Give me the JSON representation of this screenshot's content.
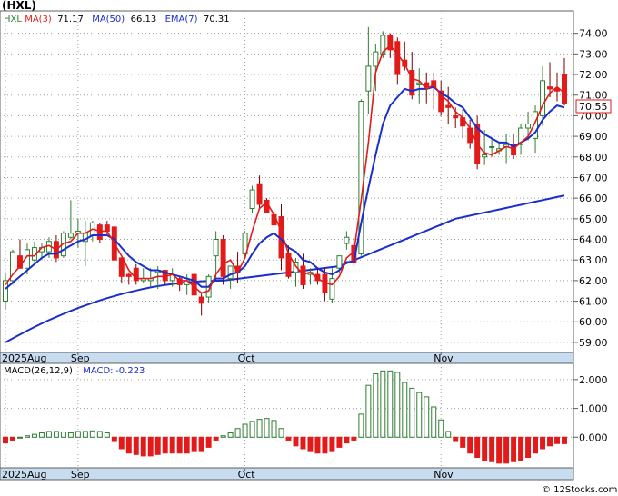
{
  "ticker_title": "(HXL)",
  "footer": "© 12Stocks.com",
  "colors": {
    "up": "#2e7d32",
    "down": "#e31a1a",
    "ma3": "#e31a1a",
    "ma50": "#1a2ecc",
    "ema7": "#1a2ecc",
    "band": "#c8dcf0",
    "grid": "#a0a0a0",
    "border": "#606060",
    "price_tag": "#e31a1a"
  },
  "chart_data": [
    {
      "type": "candlestick",
      "legend": [
        {
          "label": "HXL",
          "value": "",
          "color": "#2e7d32"
        },
        {
          "label": "MA(3)",
          "value": "71.17",
          "color": "#e31a1a"
        },
        {
          "label": "MA(50)",
          "value": "66.13",
          "color": "#1a2ecc"
        },
        {
          "label": "EMA(7)",
          "value": "70.31",
          "color": "#1a2ecc"
        }
      ],
      "last_price_label": "70.55",
      "ylim": [
        58.6,
        75.0
      ],
      "yticks": [
        "59.00",
        "60.00",
        "61.00",
        "62.00",
        "63.00",
        "64.00",
        "65.00",
        "66.00",
        "67.00",
        "68.00",
        "69.00",
        "70.00",
        "71.00",
        "72.00",
        "73.00",
        "74.00"
      ],
      "month_labels": [
        {
          "label": "2025Aug",
          "index": 0
        },
        {
          "label": "Sep",
          "index": 10
        },
        {
          "label": "Oct",
          "index": 33
        },
        {
          "label": "Nov",
          "index": 60
        }
      ],
      "candles": [
        [
          61.0,
          62.4,
          60.6,
          62.0
        ],
        [
          62.0,
          63.5,
          61.8,
          63.4
        ],
        [
          63.2,
          64.0,
          62.8,
          62.6
        ],
        [
          62.6,
          63.8,
          62.3,
          63.5
        ],
        [
          63.0,
          63.9,
          62.9,
          63.6
        ],
        [
          63.4,
          63.8,
          63.0,
          63.6
        ],
        [
          63.4,
          64.1,
          63.1,
          63.9
        ],
        [
          63.9,
          64.2,
          62.9,
          63.1
        ],
        [
          63.2,
          64.4,
          63.1,
          64.3
        ],
        [
          64.1,
          65.9,
          64.0,
          64.3
        ],
        [
          64.3,
          65.0,
          63.6,
          64.4
        ],
        [
          63.9,
          64.9,
          62.7,
          64.3
        ],
        [
          64.2,
          64.9,
          63.9,
          64.8
        ],
        [
          64.7,
          64.8,
          63.8,
          64.0
        ],
        [
          64.7,
          64.9,
          64.2,
          64.4
        ],
        [
          64.6,
          64.6,
          63.0,
          63.0
        ],
        [
          63.1,
          63.1,
          61.9,
          62.2
        ],
        [
          62.3,
          62.4,
          61.8,
          62.2
        ],
        [
          62.6,
          62.8,
          61.8,
          62.0
        ],
        [
          62.0,
          62.6,
          61.9,
          62.1
        ],
        [
          62.0,
          62.6,
          61.7,
          62.1
        ],
        [
          62.4,
          62.7,
          61.6,
          62.5
        ],
        [
          62.5,
          62.5,
          61.8,
          62.0
        ],
        [
          62.0,
          62.6,
          61.7,
          62.3
        ],
        [
          62.1,
          62.2,
          61.5,
          61.8
        ],
        [
          61.8,
          62.3,
          61.3,
          62.0
        ],
        [
          62.3,
          62.3,
          61.3,
          61.3
        ],
        [
          61.2,
          61.4,
          60.3,
          60.9
        ],
        [
          61.2,
          62.3,
          60.9,
          62.2
        ],
        [
          63.2,
          64.4,
          62.1,
          64.0
        ],
        [
          64.0,
          64.2,
          61.8,
          62.2
        ],
        [
          62.1,
          62.7,
          61.6,
          62.7
        ],
        [
          62.7,
          63.4,
          61.9,
          62.4
        ],
        [
          63.3,
          64.4,
          63.1,
          64.3
        ],
        [
          65.5,
          66.6,
          65.3,
          66.4
        ],
        [
          66.7,
          67.1,
          65.5,
          65.7
        ],
        [
          65.9,
          66.0,
          65.4,
          65.3
        ],
        [
          65.2,
          66.2,
          64.6,
          64.7
        ],
        [
          65.1,
          65.7,
          62.5,
          63.1
        ],
        [
          63.3,
          63.7,
          62.1,
          62.2
        ],
        [
          62.4,
          63.1,
          61.7,
          62.9
        ],
        [
          62.7,
          63.3,
          61.6,
          61.8
        ],
        [
          62.3,
          62.6,
          61.8,
          62.4
        ],
        [
          62.3,
          62.6,
          61.8,
          62.0
        ],
        [
          62.3,
          62.6,
          61.0,
          61.4
        ],
        [
          61.1,
          62.6,
          60.9,
          62.1
        ],
        [
          62.6,
          63.2,
          62.4,
          63.2
        ],
        [
          63.8,
          64.4,
          63.5,
          64.1
        ],
        [
          63.7,
          64.1,
          62.7,
          62.9
        ],
        [
          63.3,
          70.8,
          63.2,
          70.7
        ],
        [
          71.2,
          74.3,
          70.1,
          72.4
        ],
        [
          72.4,
          73.5,
          71.2,
          73.1
        ],
        [
          73.0,
          74.1,
          72.8,
          73.9
        ],
        [
          73.9,
          74.0,
          72.8,
          73.2
        ],
        [
          73.6,
          73.8,
          71.5,
          72.0
        ],
        [
          72.7,
          73.6,
          72.2,
          72.4
        ],
        [
          72.2,
          73.1,
          70.8,
          71.0
        ],
        [
          71.5,
          72.3,
          70.6,
          71.6
        ],
        [
          71.6,
          72.1,
          70.6,
          71.4
        ],
        [
          71.7,
          72.1,
          70.3,
          71.4
        ],
        [
          71.2,
          71.7,
          70.0,
          70.2
        ],
        [
          70.5,
          71.4,
          69.6,
          70.4
        ],
        [
          70.0,
          70.4,
          69.4,
          69.9
        ],
        [
          69.9,
          70.3,
          68.9,
          69.5
        ],
        [
          69.4,
          69.8,
          68.4,
          68.7
        ],
        [
          69.6,
          70.0,
          67.4,
          67.7
        ],
        [
          68.0,
          69.3,
          67.6,
          68.1
        ],
        [
          68.5,
          68.9,
          68.0,
          68.5
        ],
        [
          68.3,
          68.7,
          68.1,
          68.4
        ],
        [
          68.5,
          69.1,
          67.7,
          68.6
        ],
        [
          68.6,
          69.1,
          67.9,
          68.1
        ],
        [
          68.6,
          69.6,
          68.1,
          69.4
        ],
        [
          69.4,
          70.2,
          68.8,
          69.6
        ],
        [
          68.9,
          70.5,
          68.2,
          70.2
        ],
        [
          70.0,
          72.4,
          69.5,
          71.7
        ],
        [
          71.4,
          72.6,
          70.9,
          71.3
        ],
        [
          71.3,
          72.1,
          70.7,
          71.2
        ],
        [
          72.0,
          72.8,
          70.5,
          70.6
        ]
      ],
      "ma3": [
        61.8,
        62.3,
        62.7,
        63.2,
        63.2,
        63.6,
        63.7,
        63.5,
        63.8,
        63.9,
        64.3,
        64.3,
        64.5,
        64.4,
        64.4,
        63.8,
        63.2,
        62.5,
        62.1,
        62.1,
        62.1,
        62.2,
        62.2,
        62.3,
        62.0,
        62.0,
        61.7,
        61.4,
        61.5,
        62.3,
        62.8,
        63.0,
        62.4,
        63.1,
        64.4,
        65.5,
        65.8,
        65.2,
        64.4,
        63.3,
        62.7,
        62.3,
        62.4,
        62.1,
        61.9,
        61.8,
        62.2,
        63.1,
        63.4,
        65.9,
        68.7,
        72.1,
        73.1,
        73.4,
        73.0,
        72.5,
        71.8,
        71.7,
        71.3,
        71.5,
        71.0,
        70.7,
        70.2,
        69.9,
        69.4,
        68.6,
        68.2,
        68.1,
        68.3,
        68.5,
        68.4,
        68.7,
        69.0,
        69.7,
        70.5,
        71.1,
        71.4,
        71.1
      ],
      "ema7": [
        61.6,
        61.9,
        62.2,
        62.5,
        62.8,
        63.1,
        63.3,
        63.3,
        63.5,
        63.7,
        63.9,
        64.0,
        64.2,
        64.2,
        64.2,
        64.0,
        63.6,
        63.2,
        62.9,
        62.7,
        62.5,
        62.5,
        62.4,
        62.3,
        62.2,
        62.1,
        62.0,
        61.7,
        61.7,
        62.1,
        62.1,
        62.3,
        62.4,
        62.7,
        63.3,
        63.8,
        64.1,
        64.3,
        64.0,
        63.6,
        63.4,
        63.0,
        62.9,
        62.6,
        62.4,
        62.3,
        62.5,
        62.9,
        62.9,
        64.8,
        66.5,
        68.1,
        69.6,
        70.5,
        70.9,
        71.3,
        71.2,
        71.3,
        71.3,
        71.4,
        71.1,
        70.9,
        70.6,
        70.4,
        69.9,
        69.4,
        69.1,
        68.9,
        68.7,
        68.7,
        68.5,
        68.7,
        68.9,
        69.2,
        69.8,
        70.2,
        70.5,
        70.4
      ]
    },
    {
      "type": "bar",
      "legend": [
        {
          "label": "MACD(26,12,9)",
          "value": "",
          "color": "#000000"
        },
        {
          "label": "MACD:",
          "value": "-0.223",
          "color": "#1a2ecc"
        }
      ],
      "ylim": [
        -1.0,
        2.5
      ],
      "yticks": [
        "0.000",
        "1.000",
        "2.000"
      ],
      "month_labels": [
        {
          "label": "2025Aug",
          "index": 0
        },
        {
          "label": "Sep",
          "index": 10
        },
        {
          "label": "Oct",
          "index": 33
        },
        {
          "label": "Nov",
          "index": 60
        }
      ],
      "values": [
        -0.2,
        -0.1,
        0.0,
        0.05,
        0.1,
        0.15,
        0.2,
        0.2,
        0.18,
        0.15,
        0.2,
        0.2,
        0.22,
        0.2,
        0.15,
        -0.15,
        -0.4,
        -0.55,
        -0.6,
        -0.65,
        -0.65,
        -0.6,
        -0.55,
        -0.55,
        -0.55,
        -0.55,
        -0.5,
        -0.5,
        -0.35,
        -0.1,
        0.05,
        0.15,
        0.3,
        0.45,
        0.55,
        0.62,
        0.65,
        0.58,
        0.3,
        -0.1,
        -0.3,
        -0.4,
        -0.5,
        -0.55,
        -0.55,
        -0.5,
        -0.35,
        -0.2,
        -0.1,
        0.8,
        1.8,
        2.2,
        2.3,
        2.3,
        2.25,
        1.9,
        1.7,
        1.55,
        1.4,
        1.05,
        0.6,
        0.2,
        -0.15,
        -0.35,
        -0.55,
        -0.7,
        -0.8,
        -0.85,
        -0.9,
        -0.9,
        -0.85,
        -0.8,
        -0.7,
        -0.55,
        -0.4,
        -0.3,
        -0.22,
        -0.223
      ]
    }
  ]
}
